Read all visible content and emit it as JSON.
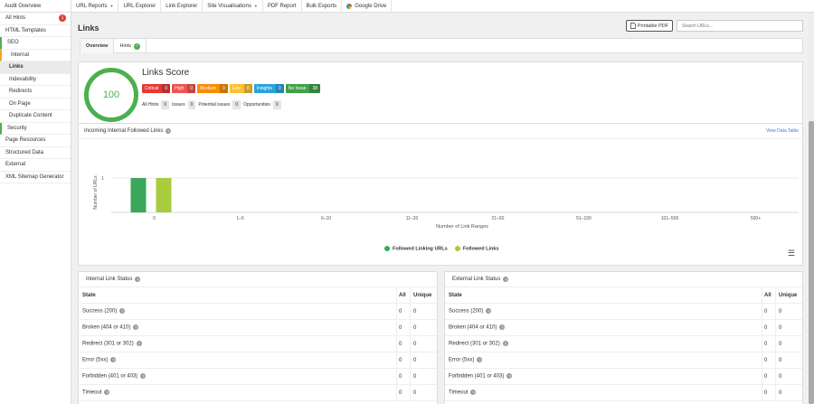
{
  "topnav": {
    "left": "Audit Overview",
    "items": [
      {
        "label": "URL Reports",
        "caret": true
      },
      {
        "label": "URL Explorer",
        "caret": false
      },
      {
        "label": "Link Explorer",
        "caret": false
      },
      {
        "label": "Site Visualisations",
        "caret": true
      },
      {
        "label": "PDF Report",
        "caret": false
      },
      {
        "label": "Bulk Exports",
        "caret": false
      },
      {
        "label": "Google Drive",
        "caret": false
      }
    ]
  },
  "sidebar": {
    "items": [
      {
        "label": "All Hints",
        "badge": "1"
      },
      {
        "label": "HTML Templates"
      },
      {
        "label": "SEO"
      },
      {
        "label": "Internal"
      },
      {
        "label": "Links"
      },
      {
        "label": "Indexability"
      },
      {
        "label": "Redirects"
      },
      {
        "label": "On Page"
      },
      {
        "label": "Duplicate Content"
      },
      {
        "label": "Security"
      },
      {
        "label": "Page Resources"
      },
      {
        "label": "Structured Data"
      },
      {
        "label": "External"
      },
      {
        "label": "XML Sitemap Generator"
      }
    ]
  },
  "page": {
    "title": "Links",
    "pdf_button": "Printable PDF",
    "search_placeholder": "Search URLs..."
  },
  "tabs": [
    {
      "label": "Overview"
    },
    {
      "label": "Hints"
    }
  ],
  "score": {
    "value": "100",
    "title": "Links Score",
    "severities": [
      {
        "label": "Critical",
        "count": "0",
        "color": "#e53935"
      },
      {
        "label": "High",
        "count": "0",
        "color": "#ef5350"
      },
      {
        "label": "Medium",
        "count": "0",
        "color": "#fb8c00"
      },
      {
        "label": "Low",
        "count": "0",
        "color": "#fbc02d"
      },
      {
        "label": "Insights",
        "count": "0",
        "color": "#29a3e0"
      },
      {
        "label": "No Issue",
        "count": "38",
        "color": "#43a047"
      }
    ],
    "hints": [
      {
        "label": "All Hints",
        "count": "0"
      },
      {
        "label": "Issues",
        "count": "0"
      },
      {
        "label": "Potential issues",
        "count": "0"
      },
      {
        "label": "Opportunities",
        "count": "0"
      }
    ]
  },
  "chart_card": {
    "title": "Incoming Internal Followed Links",
    "view_link": "View Data Table"
  },
  "chart_data": {
    "type": "bar",
    "categories": [
      "0",
      "1–5",
      "6–10",
      "11–20",
      "21–50",
      "51–100",
      "101–500",
      "500+"
    ],
    "series": [
      {
        "name": "Followed Linking URLs",
        "color": "#3aa85a",
        "values": [
          1,
          0,
          0,
          0,
          0,
          0,
          0,
          0
        ]
      },
      {
        "name": "Followed Links",
        "color": "#a8cc3c",
        "values": [
          1,
          0,
          0,
          0,
          0,
          0,
          0,
          0
        ]
      }
    ],
    "xlabel": "Number of Link Ranges",
    "ylabel": "Number of URLs",
    "yticks": [
      "1"
    ],
    "ylim": [
      0,
      1
    ],
    "grid": true,
    "legend": "bottom"
  },
  "internal_table": {
    "title": "Internal Link Status",
    "headers": [
      "State",
      "All",
      "Unique"
    ],
    "rows": [
      [
        "Success (200)",
        "0",
        "0"
      ],
      [
        "Broken (404 or 410)",
        "0",
        "0"
      ],
      [
        "Redirect (301 or 302)",
        "0",
        "0"
      ],
      [
        "Error (5xx)",
        "0",
        "0"
      ],
      [
        "Forbidden (401 or 403)",
        "0",
        "0"
      ],
      [
        "Timeout",
        "0",
        "0"
      ]
    ]
  },
  "external_table": {
    "title": "External Link Status",
    "headers": [
      "State",
      "All",
      "Unique"
    ],
    "rows": [
      [
        "Success (200)",
        "0",
        "0"
      ],
      [
        "Broken (404 or 410)",
        "0",
        "0"
      ],
      [
        "Redirect (301 or 302)",
        "0",
        "0"
      ],
      [
        "Error (5xx)",
        "0",
        "0"
      ],
      [
        "Forbidden (401 or 403)",
        "0",
        "0"
      ],
      [
        "Timeout",
        "0",
        "0"
      ]
    ]
  }
}
